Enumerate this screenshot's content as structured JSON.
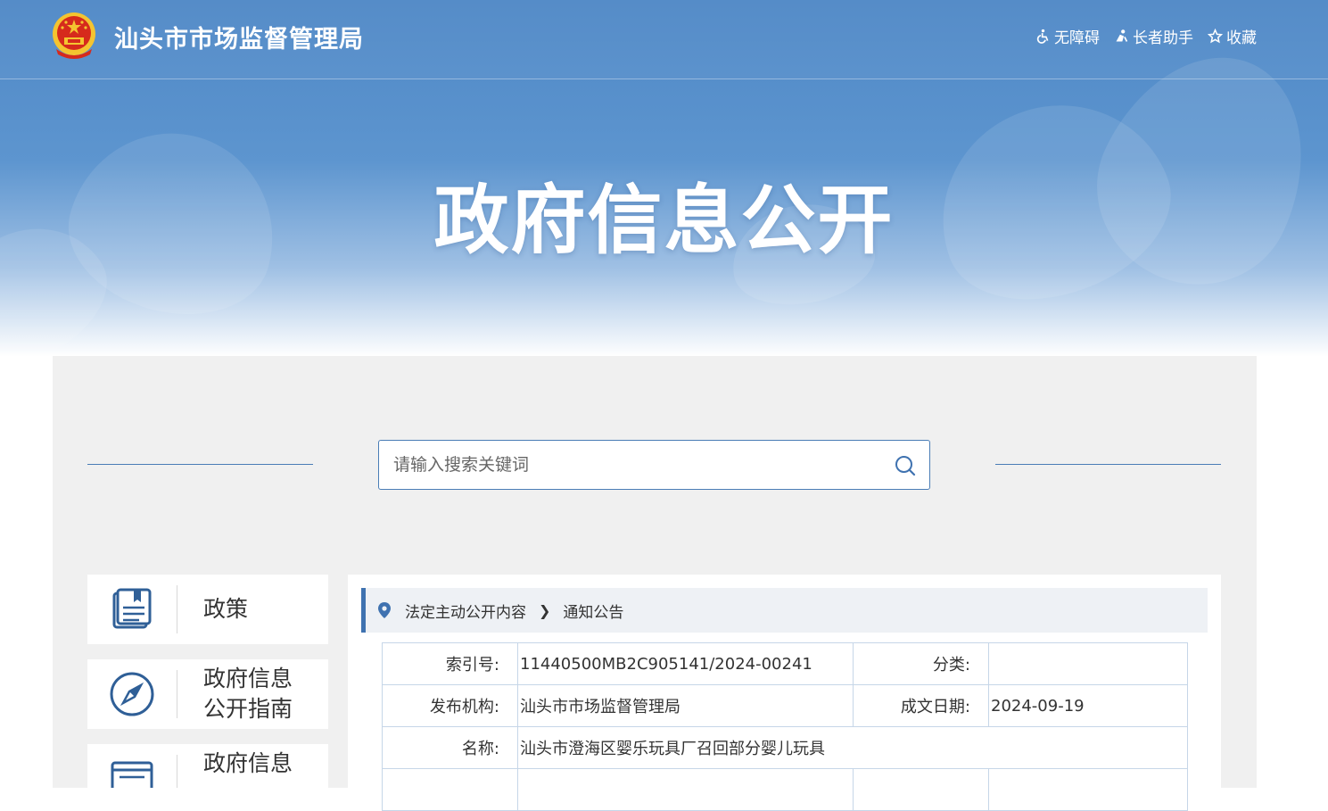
{
  "header": {
    "site_title": "汕头市市场监督管理局",
    "hero_title": "政府信息公开",
    "links": [
      {
        "icon": "wheelchair-icon",
        "label": "无障碍"
      },
      {
        "icon": "elderly-assist-icon",
        "label": "长者助手"
      },
      {
        "icon": "star-icon",
        "label": "收藏"
      }
    ]
  },
  "search": {
    "placeholder": "请输入搜索关键词",
    "value": ""
  },
  "sidebar": {
    "items": [
      {
        "icon": "book-icon",
        "label": "政策"
      },
      {
        "icon": "compass-icon",
        "label_line1": "政府信息",
        "label_line2": "公开指南"
      },
      {
        "icon": "newspaper-icon",
        "label": "政府信息"
      }
    ]
  },
  "breadcrumb": {
    "level1": "法定主动公开内容",
    "level2": "通知公告"
  },
  "meta": {
    "index_label": "索引号:",
    "index_value": "11440500MB2C905141/2024-00241",
    "category_label": "分类:",
    "category_value": "",
    "publisher_label": "发布机构:",
    "publisher_value": "汕头市市场监督管理局",
    "date_label": "成文日期:",
    "date_value": "2024-09-19",
    "name_label": "名称:",
    "name_value": "汕头市澄海区婴乐玩具厂召回部分婴儿玩具"
  },
  "colors": {
    "banner_blue": "#4f88c6",
    "accent_blue": "#3f72b0",
    "panel_gray": "#f0f0f0",
    "emblem_red": "#d62a1c",
    "emblem_gold": "#f4c430"
  }
}
